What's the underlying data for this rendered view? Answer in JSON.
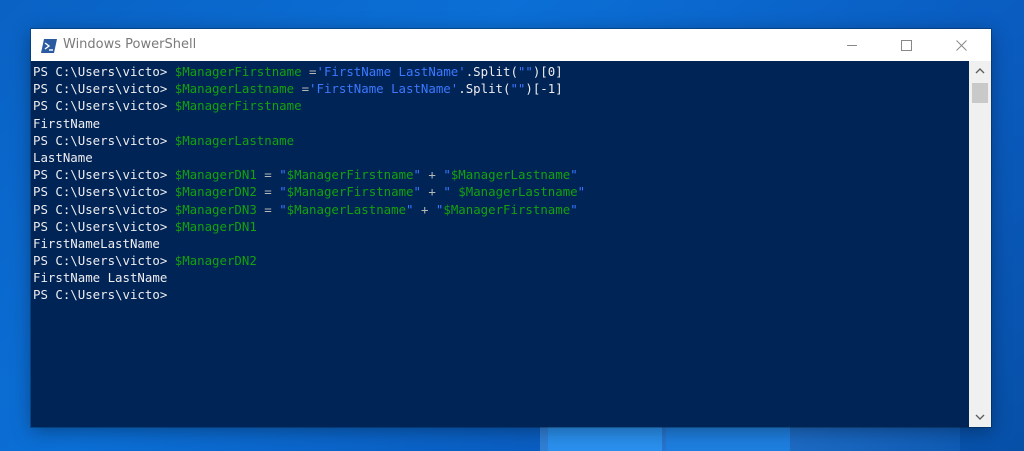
{
  "window": {
    "title": "Windows PowerShell"
  },
  "icons": {
    "app": "powershell-icon",
    "minimize": "minimize-icon",
    "maximize": "maximize-icon",
    "close": "close-icon",
    "scroll_up": "chevron-up-icon",
    "scroll_down": "chevron-down-icon"
  },
  "colors": {
    "console_bg": "#012456",
    "variable": "#13a10e",
    "string": "#3b78ff",
    "text": "#eeedf0"
  },
  "console": {
    "lines": [
      [
        {
          "t": "prompt",
          "v": "PS C:\\Users\\victo> "
        },
        {
          "t": "var",
          "v": "$ManagerFirstname"
        },
        {
          "t": "op",
          "v": " ="
        },
        {
          "t": "str",
          "v": "'FirstName LastName'"
        },
        {
          "t": "plain",
          "v": ".Split("
        },
        {
          "t": "str",
          "v": "\"\""
        },
        {
          "t": "plain",
          "v": ")[0]"
        }
      ],
      [
        {
          "t": "prompt",
          "v": "PS C:\\Users\\victo> "
        },
        {
          "t": "var",
          "v": "$ManagerLastname"
        },
        {
          "t": "op",
          "v": " ="
        },
        {
          "t": "str",
          "v": "'FirstName LastName'"
        },
        {
          "t": "plain",
          "v": ".Split("
        },
        {
          "t": "str",
          "v": "\"\""
        },
        {
          "t": "plain",
          "v": ")[-1]"
        }
      ],
      [
        {
          "t": "prompt",
          "v": "PS C:\\Users\\victo> "
        },
        {
          "t": "var",
          "v": "$ManagerFirstname"
        }
      ],
      [
        {
          "t": "out",
          "v": "FirstName"
        }
      ],
      [
        {
          "t": "prompt",
          "v": "PS C:\\Users\\victo> "
        },
        {
          "t": "var",
          "v": "$ManagerLastname"
        }
      ],
      [
        {
          "t": "out",
          "v": "LastName"
        }
      ],
      [
        {
          "t": "prompt",
          "v": "PS C:\\Users\\victo> "
        },
        {
          "t": "var",
          "v": "$ManagerDN1"
        },
        {
          "t": "op",
          "v": " = "
        },
        {
          "t": "str",
          "v": "\""
        },
        {
          "t": "var",
          "v": "$ManagerFirstname"
        },
        {
          "t": "str",
          "v": "\""
        },
        {
          "t": "op",
          "v": " + "
        },
        {
          "t": "str",
          "v": "\""
        },
        {
          "t": "var",
          "v": "$ManagerLastname"
        },
        {
          "t": "str",
          "v": "\""
        }
      ],
      [
        {
          "t": "prompt",
          "v": "PS C:\\Users\\victo> "
        },
        {
          "t": "var",
          "v": "$ManagerDN2"
        },
        {
          "t": "op",
          "v": " = "
        },
        {
          "t": "str",
          "v": "\""
        },
        {
          "t": "var",
          "v": "$ManagerFirstname"
        },
        {
          "t": "str",
          "v": "\""
        },
        {
          "t": "op",
          "v": " + "
        },
        {
          "t": "str",
          "v": "\" "
        },
        {
          "t": "var",
          "v": "$ManagerLastname"
        },
        {
          "t": "str",
          "v": "\""
        }
      ],
      [
        {
          "t": "prompt",
          "v": "PS C:\\Users\\victo> "
        },
        {
          "t": "var",
          "v": "$ManagerDN3"
        },
        {
          "t": "op",
          "v": " = "
        },
        {
          "t": "str",
          "v": "\""
        },
        {
          "t": "var",
          "v": "$ManagerLastname"
        },
        {
          "t": "str",
          "v": "\""
        },
        {
          "t": "op",
          "v": " + "
        },
        {
          "t": "str",
          "v": "\""
        },
        {
          "t": "var",
          "v": "$ManagerFirstname"
        },
        {
          "t": "str",
          "v": "\""
        }
      ],
      [
        {
          "t": "prompt",
          "v": "PS C:\\Users\\victo> "
        },
        {
          "t": "var",
          "v": "$ManagerDN1"
        }
      ],
      [
        {
          "t": "out",
          "v": "FirstNameLastName"
        }
      ],
      [
        {
          "t": "prompt",
          "v": "PS C:\\Users\\victo> "
        },
        {
          "t": "var",
          "v": "$ManagerDN2"
        }
      ],
      [
        {
          "t": "out",
          "v": "FirstName LastName"
        }
      ],
      [
        {
          "t": "prompt",
          "v": "PS C:\\Users\\victo>"
        }
      ]
    ]
  }
}
